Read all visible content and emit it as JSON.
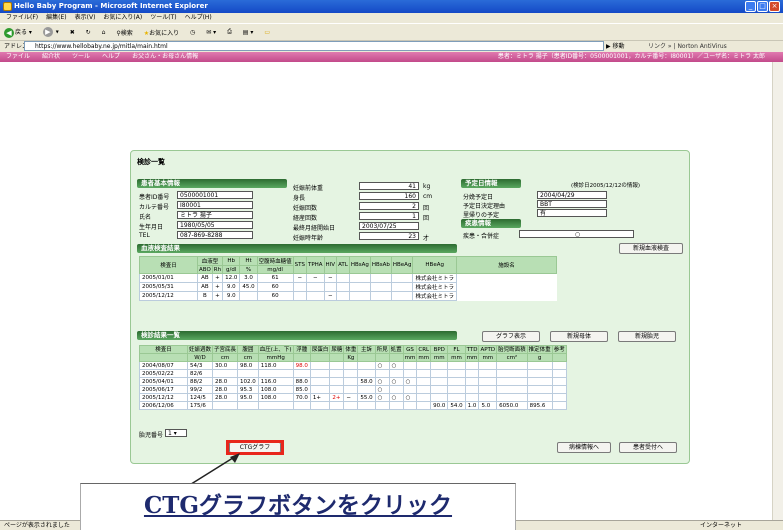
{
  "window": {
    "title": "Hello Baby Program - Microsoft Internet Explorer"
  },
  "menu": [
    "ファイル(F)",
    "編集(E)",
    "表示(V)",
    "お気に入り(A)",
    "ツール(T)",
    "ヘルプ(H)"
  ],
  "toolbar": {
    "back": "戻る",
    "search": "検索",
    "favorites": "お気に入り",
    "go": "移動",
    "links": "リンク",
    "norton": "Norton AntiVirus"
  },
  "address": {
    "label": "アドレス(D)",
    "url": "https://www.hellobaby.ne.jp/mitla/main.html"
  },
  "apptabs": [
    "ファイル",
    "紹介状",
    "ツール",
    "ヘルプ",
    "お父さん・お母さん情報"
  ],
  "patient_header": "患者：ミトラ 揚子（患者ID番号：0500001001，カルテ番号：I80001）／ユーザ名：ミトラ 太郎",
  "page_title": "検診一覧",
  "patient": {
    "section": "患者基本情報",
    "fields": [
      [
        "患者ID番号",
        "0500001001"
      ],
      [
        "カルテ番号",
        "I80001"
      ],
      [
        "氏名",
        "ミトラ 揚子"
      ],
      [
        "生年月日",
        "1980/05/05"
      ],
      [
        "TEL",
        "087-869-8288"
      ]
    ],
    "pregnancy": [
      [
        "妊娠前体重",
        "41",
        "kg"
      ],
      [
        "身長",
        "160",
        "cm"
      ],
      [
        "妊娠回数",
        "2",
        "回"
      ],
      [
        "経産回数",
        "1",
        "回"
      ],
      [
        "最終月経開始日",
        "2003/07/25",
        ""
      ],
      [
        "妊娠時年齢",
        "23",
        "才"
      ]
    ]
  },
  "schedule": {
    "section": "予定日情報",
    "note": "(検診日2005/12/12の情報)",
    "fields": [
      [
        "分娩予定日",
        "2004/04/29"
      ],
      [
        "予定日決定理由",
        "BBT"
      ],
      [
        "里帰りの予定",
        "有"
      ]
    ]
  },
  "disease": {
    "section": "疾患情報",
    "label": "疾患・合併症",
    "value": "○"
  },
  "blood": {
    "section": "血液検査結果",
    "new_button": "新規血液検査",
    "headers": [
      "検査日",
      "血液型",
      "Hb",
      "Ht",
      "空腹時血糖値",
      "STS",
      "TPHA",
      "HIV",
      "ATL",
      "HBsAg",
      "HBsAb",
      "HBeAg",
      "HBeAg",
      "施設名"
    ],
    "subheaders": [
      "ABO",
      "Rh",
      "g/dl",
      "%",
      "mg/dl"
    ],
    "rows": [
      [
        "2005/01/01",
        "AB",
        "+",
        "12.0",
        "3.0",
        "61",
        "−",
        "−",
        "−",
        "",
        "",
        "",
        "",
        "株式会社ミトラ"
      ],
      [
        "2005/05/31",
        "AB",
        "+",
        "9.0",
        "45.0",
        "60",
        "",
        "",
        "",
        "",
        "",
        "",
        "",
        "株式会社ミトラ"
      ],
      [
        "2005/12/12",
        "B",
        "+",
        "9.0",
        "",
        "60",
        "",
        "",
        "−",
        "",
        "",
        "",
        "",
        "株式会社ミトラ"
      ]
    ]
  },
  "exam": {
    "section": "検診結果一覧",
    "buttons": [
      "グラフ表示",
      "新規母体",
      "新規胎児"
    ],
    "headers": [
      "検査日",
      "妊娠週数",
      "子宮底長",
      "腹囲",
      "血圧(上、下)",
      "浮腫",
      "尿蛋白",
      "尿糖",
      "体重",
      "主訴",
      "所見",
      "処置",
      "GS",
      "CRL",
      "BPD",
      "FL",
      "TTD",
      "APTD",
      "胎児断面積",
      "推定体重",
      "参考"
    ],
    "units": [
      "",
      "W/D",
      "cm",
      "cm",
      "mmHg",
      "",
      "",
      "",
      "Kg",
      "",
      "",
      "",
      "mm",
      "mm",
      "mm",
      "mm",
      "mm",
      "mm",
      "cm²",
      "g",
      ""
    ],
    "rows": [
      [
        "2004/08/07",
        "54/3",
        "30.0",
        "98.0",
        "118.0",
        "98.0",
        "",
        "",
        "",
        "",
        "○",
        "○",
        "",
        "",
        "",
        "",
        "",
        "",
        "",
        "",
        ""
      ],
      [
        "2005/02/22",
        "82/6",
        "",
        "",
        "",
        "",
        "",
        "",
        "",
        "",
        "",
        "",
        "",
        "",
        "",
        "",
        "",
        "",
        "",
        "",
        ""
      ],
      [
        "2005/04/01",
        "88/2",
        "28.0",
        "102.0",
        "116.0",
        "88.0",
        "",
        "",
        "",
        "58.0",
        "○",
        "○",
        "○",
        "",
        "",
        "",
        "",
        "",
        "",
        "",
        ""
      ],
      [
        "2005/06/17",
        "99/2",
        "28.0",
        "95.3",
        "108.0",
        "85.0",
        "",
        "",
        "",
        "",
        "○",
        "",
        "",
        "",
        "",
        "",
        "",
        "",
        "",
        "",
        ""
      ],
      [
        "2005/12/12",
        "124/5",
        "28.0",
        "95.0",
        "108.0",
        "70.0",
        "1+",
        "2+",
        "−",
        "55.0",
        "○",
        "○",
        "○",
        "",
        "",
        "",
        "",
        "",
        "",
        "",
        ""
      ],
      [
        "2006/12/06",
        "175/6",
        "",
        "",
        "",
        "",
        "",
        "",
        "",
        "",
        "",
        "",
        "",
        "",
        "90.0",
        "54.0",
        "1.0",
        "5.0",
        "6050.0",
        "895.6",
        ""
      ]
    ],
    "fetus_label": "胎児番号",
    "fetus_value": "1"
  },
  "bottom_buttons": {
    "ctg": "CTGグラフ",
    "medical": "病棟情報へ",
    "reception": "患者受付へ"
  },
  "status": {
    "text": "ページが表示されました",
    "zone": "インターネット"
  },
  "callout": "CTGグラフボタンをクリック"
}
